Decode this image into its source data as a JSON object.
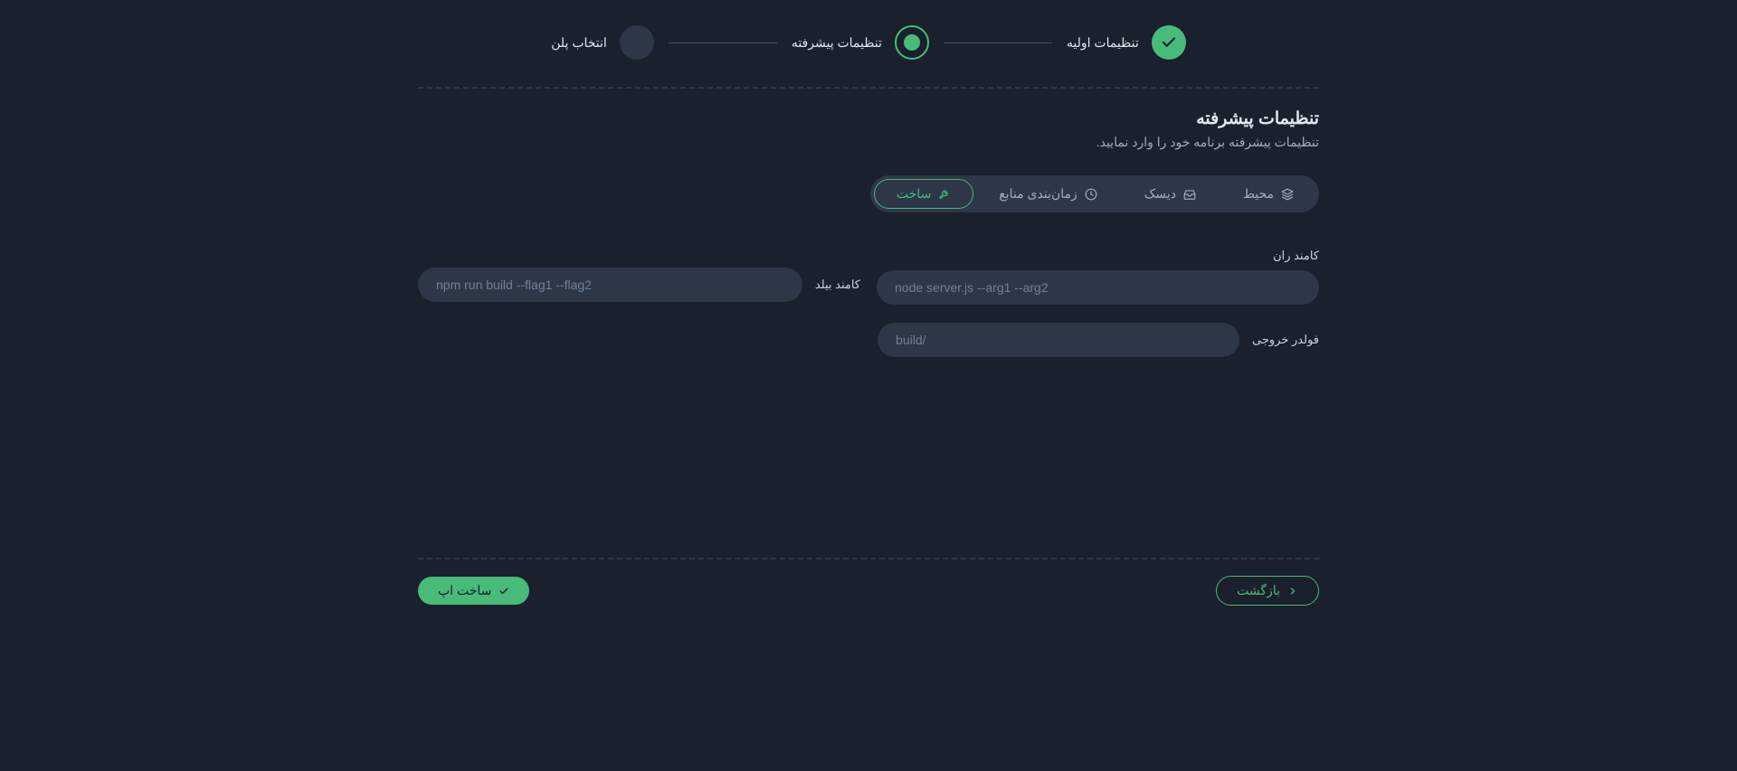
{
  "stepper": {
    "steps": [
      {
        "label": "تنظیمات اولیه",
        "state": "completed"
      },
      {
        "label": "تنظیمات پیشرفته",
        "state": "active"
      },
      {
        "label": "انتخاب پلن",
        "state": "pending"
      }
    ]
  },
  "section": {
    "title": "تنظیمات پیشرفته",
    "subtitle": "تنظیمات پیشرفته برنامه خود را وارد نمایید."
  },
  "tabs": {
    "items": [
      {
        "id": "env",
        "label": "محیط",
        "icon": "stack-icon"
      },
      {
        "id": "disk",
        "label": "دیسک",
        "icon": "inbox-icon"
      },
      {
        "id": "cron",
        "label": "زمان‌بندی منابع",
        "icon": "clock-icon"
      },
      {
        "id": "build",
        "label": "ساخت",
        "icon": "wrench-icon",
        "active": true
      }
    ]
  },
  "form": {
    "run_command_label": "کامند ران",
    "run_command_placeholder": "node server.js --arg1 --arg2",
    "build_command_label": "کامند بیلد",
    "build_command_placeholder": "npm run build --flag1 --flag2",
    "output_folder_label": "فولدر خروجی",
    "output_folder_placeholder": "build/"
  },
  "actions": {
    "back_label": "بازگشت",
    "submit_label": "ساخت اپ"
  },
  "colors": {
    "accent": "#48bb78",
    "bg": "#1a202c",
    "surface": "#2d3748"
  }
}
